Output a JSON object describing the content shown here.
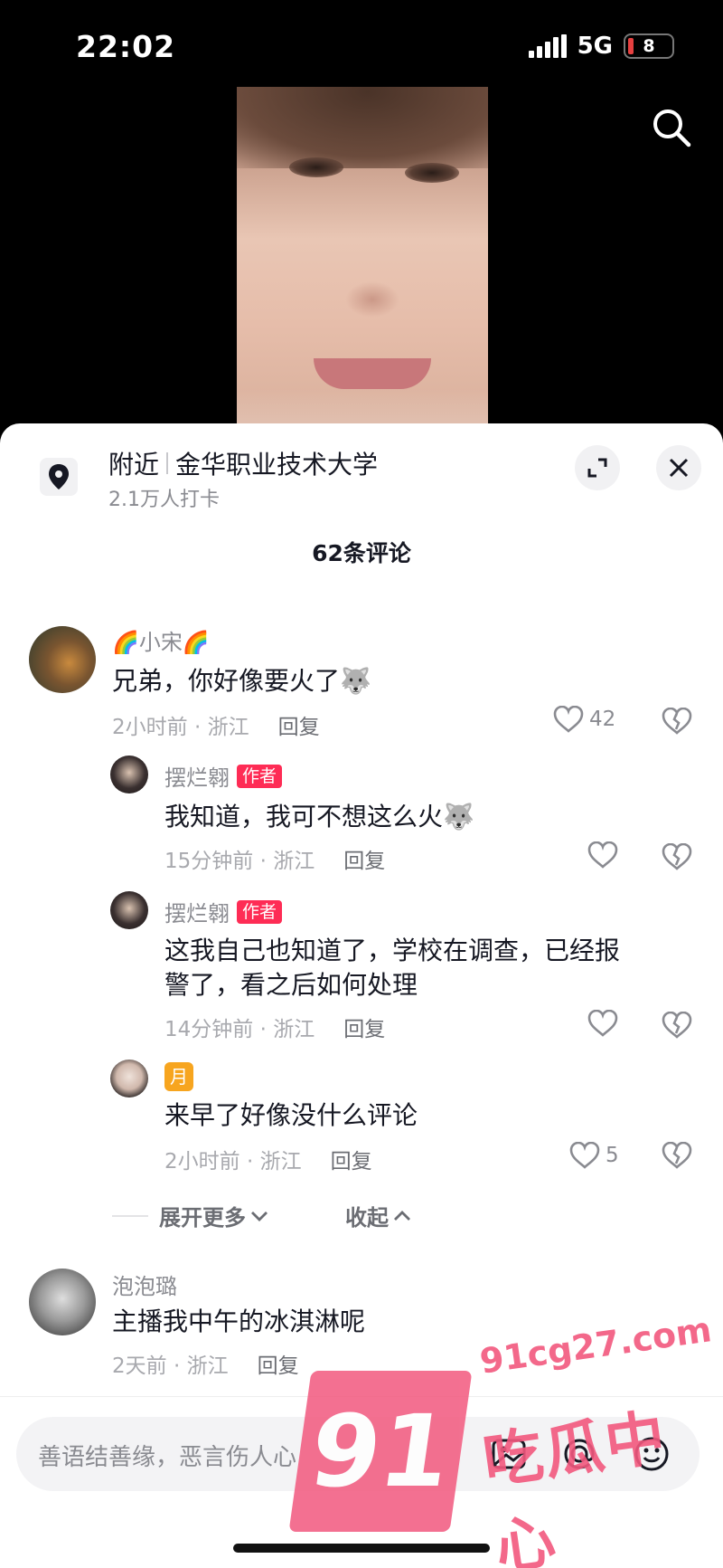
{
  "status_bar": {
    "time": "22:02",
    "network": "5G",
    "battery": "8"
  },
  "location": {
    "prefix": "附近",
    "name": "金华职业技术大学",
    "checkins": "2.1万人打卡"
  },
  "comment_count": "62条评论",
  "comments": [
    {
      "user": "🌈小宋🌈",
      "text": "兄弟，你好像要火了",
      "emoji": "🐺",
      "time": "2小时前 · 浙江",
      "reply": "回复",
      "likes": "42"
    },
    {
      "user": "摆烂翱",
      "tag": "作者",
      "text": "我知道，我可不想这么火",
      "emoji": "🐺",
      "time": "15分钟前 · 浙江",
      "reply": "回复"
    },
    {
      "user": "摆烂翱",
      "tag": "作者",
      "text_line1": "这我自己也知道了，学校在调查，已经报",
      "text_line2": "警了，看之后如何处理",
      "time": "14分钟前 · 浙江",
      "reply": "回复"
    },
    {
      "tag": "月",
      "text": "来早了好像没什么评论",
      "time": "2小时前 · 浙江",
      "reply": "回复",
      "likes": "5"
    },
    {
      "user": "泡泡璐",
      "text": "主播我中午的冰淇淋呢",
      "time": "2天前 · 浙江",
      "reply": "回复"
    }
  ],
  "expand_more": "展开更多",
  "collapse": "收起",
  "input": {
    "placeholder": "善语结善缘，恶言伤人心"
  },
  "watermark": {
    "badge": "91",
    "url": "91cg27.com",
    "name": "吃瓜中心"
  },
  "colors": {
    "accent": "#fe2c55",
    "watermark": "#f2587e"
  }
}
